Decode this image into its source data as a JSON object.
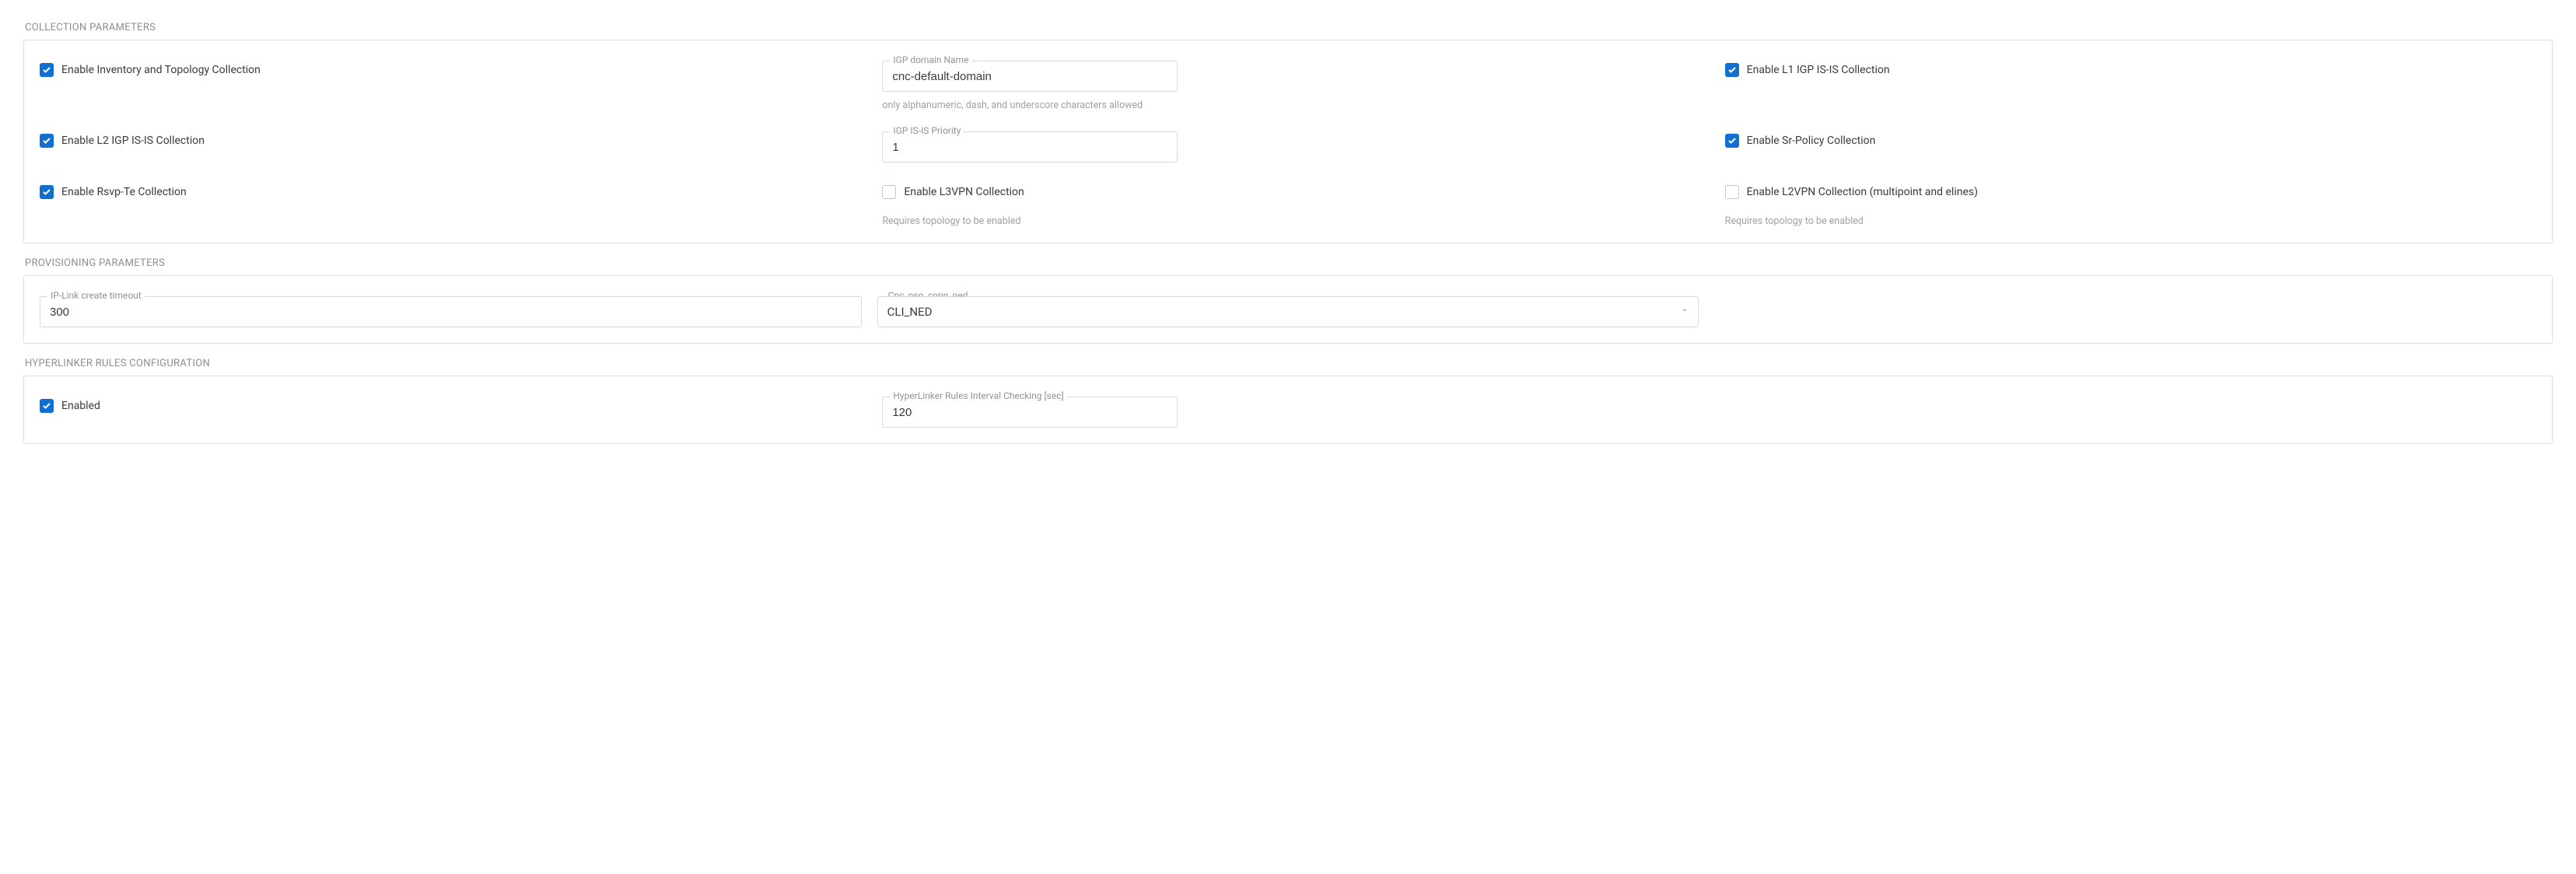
{
  "collection": {
    "title": "COLLECTION PARAMETERS",
    "row1": {
      "inventory_label": "Enable Inventory and Topology Collection",
      "igp_domain_label": "IGP domain Name",
      "igp_domain_value": "cnc-default-domain",
      "igp_domain_hint": "only alphanumeric, dash, and underscore characters allowed",
      "l1_isis_label": "Enable L1 IGP IS-IS Collection"
    },
    "row2": {
      "l2_isis_label": "Enable L2 IGP IS-IS Collection",
      "isis_priority_label": "IGP IS-IS Priority",
      "isis_priority_value": "1",
      "sr_policy_label": "Enable Sr-Policy Collection"
    },
    "row3": {
      "rsvp_label": "Enable Rsvp-Te Collection",
      "l3vpn_label": "Enable L3VPN Collection",
      "l3vpn_hint": "Requires topology to be enabled",
      "l2vpn_label": "Enable L2VPN Collection (multipoint and elines)",
      "l2vpn_hint": "Requires topology to be enabled"
    }
  },
  "provisioning": {
    "title": "PROVISIONING PARAMETERS",
    "iplink_label": "IP-Link create timeout",
    "iplink_value": "300",
    "ned_label": "Cnc_nso_conn_ned",
    "ned_value": "CLI_NED"
  },
  "hyperlinker": {
    "title": "HYPERLINKER RULES CONFIGURATION",
    "enabled_label": "Enabled",
    "interval_label": "HyperLinker Rules Interval Checking [sec]",
    "interval_value": "120"
  }
}
